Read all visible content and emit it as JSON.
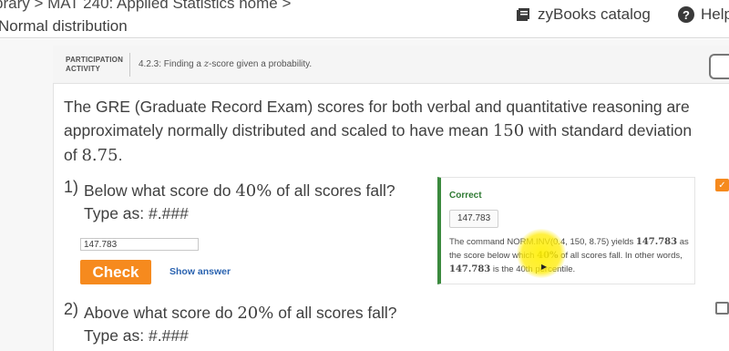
{
  "header": {
    "breadcrumb_prefix": "brary >",
    "breadcrumb_course": "MAT 240: Applied Statistics home",
    "breadcrumb_suffix": ">",
    "section_title": "Normal distribution",
    "catalog_label": "zyBooks catalog",
    "help_icon_glyph": "?",
    "help_label": "Help"
  },
  "activity": {
    "type_line1": "PARTICIPATION",
    "type_line2": "ACTIVITY",
    "number": "4.2.3: Finding a",
    "title_var": "z",
    "title_rest": "-score given a probability."
  },
  "problem": {
    "text_before_mean": "The GRE (Graduate Record Exam) scores for both verbal and quantitative reasoning are approximately normally distributed and scaled to have mean",
    "mean": "150",
    "text_mid": "with standard deviation of",
    "sd": "8.75",
    "text_end": "."
  },
  "questions": [
    {
      "number": "1)",
      "text_before": "Below what score do",
      "percent": "40%",
      "text_after": "of all scores fall?",
      "type_hint": "Type as: #.###",
      "input_value": "147.783",
      "check_label": "Check",
      "show_answer_label": "Show answer",
      "feedback": {
        "status": "Correct",
        "answer": "147.783",
        "explain_1": "The command NORM.INV(0.4, 150, 8.75) yields",
        "explain_val1": "147.783",
        "explain_2": "as the score below which",
        "explain_pct": "40%",
        "explain_3": "of all scores fall. In other words,",
        "explain_val2": "147.783",
        "explain_4": "is the 40th percentile."
      }
    },
    {
      "number": "2)",
      "text_before": "Above what score do",
      "percent": "20%",
      "text_after": "of all scores fall?",
      "type_hint": "Type as: #.###"
    }
  ],
  "colors": {
    "accent_orange": "#f68a1e",
    "correct_green": "#3b8a3e",
    "link_blue": "#2a63b0"
  }
}
